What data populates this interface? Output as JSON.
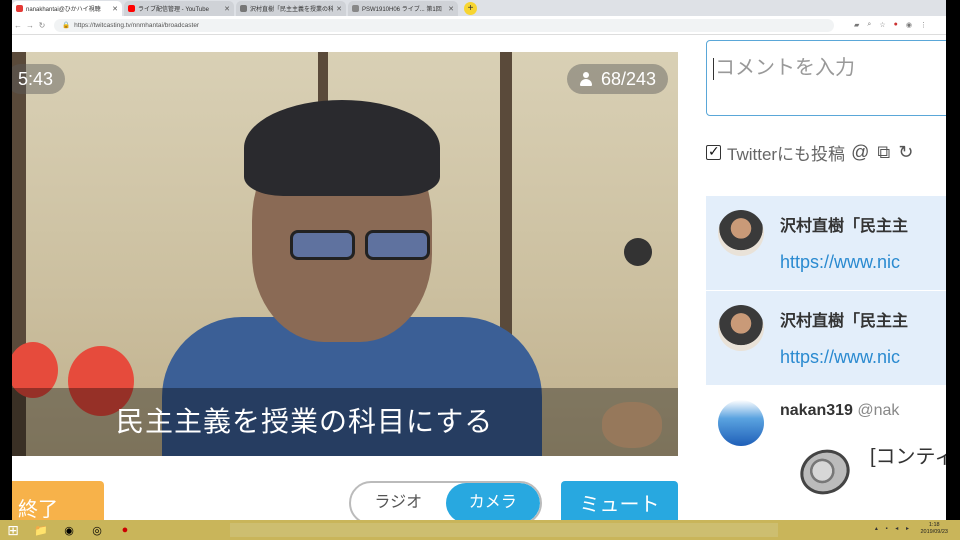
{
  "browser": {
    "tabs": [
      {
        "title": "nanakhantai@ひかハイ視聴",
        "active": true,
        "favicon_color": "#e53935"
      },
      {
        "title": "ライブ配信管理 - YouTube",
        "active": false,
        "favicon_color": "#ff0000"
      },
      {
        "title": "沢村直樹「民主主義を授業の科目に」",
        "active": false,
        "favicon_color": "#777777"
      },
      {
        "title": "PSW1910H06 ライブ... 第1回",
        "active": false,
        "favicon_color": "#888888"
      }
    ],
    "new_tab": "+",
    "url": "https://twitcasting.tv/nnmhantai/broadcaster"
  },
  "video": {
    "timer": "5:43",
    "viewers": "68/243",
    "caption": "民主主義を授業の科目にする"
  },
  "controls": {
    "end_label": "終了",
    "radio_label": "ラジオ",
    "camera_label": "カメラ",
    "mute_label": "ミュート"
  },
  "comment": {
    "placeholder": "コメントを入力",
    "twitter_label": "Twitterにも投稿"
  },
  "messages": [
    {
      "name": "沢村直樹「民主主",
      "link": "https://www.nic",
      "highlighted": true
    },
    {
      "name": "沢村直樹「民主主",
      "link": "https://www.nic",
      "highlighted": true
    },
    {
      "name": "nakan319",
      "handle": "@nak",
      "text": "[コンティ",
      "highlighted": false
    }
  ],
  "taskbar": {
    "clock_time": "1:18",
    "clock_date": "2019/09/23"
  },
  "colors": {
    "accent": "#28a8e0",
    "end_button": "#f7b24a",
    "comment_highlight": "#e3eefa",
    "taskbar": "#c9b55a"
  }
}
